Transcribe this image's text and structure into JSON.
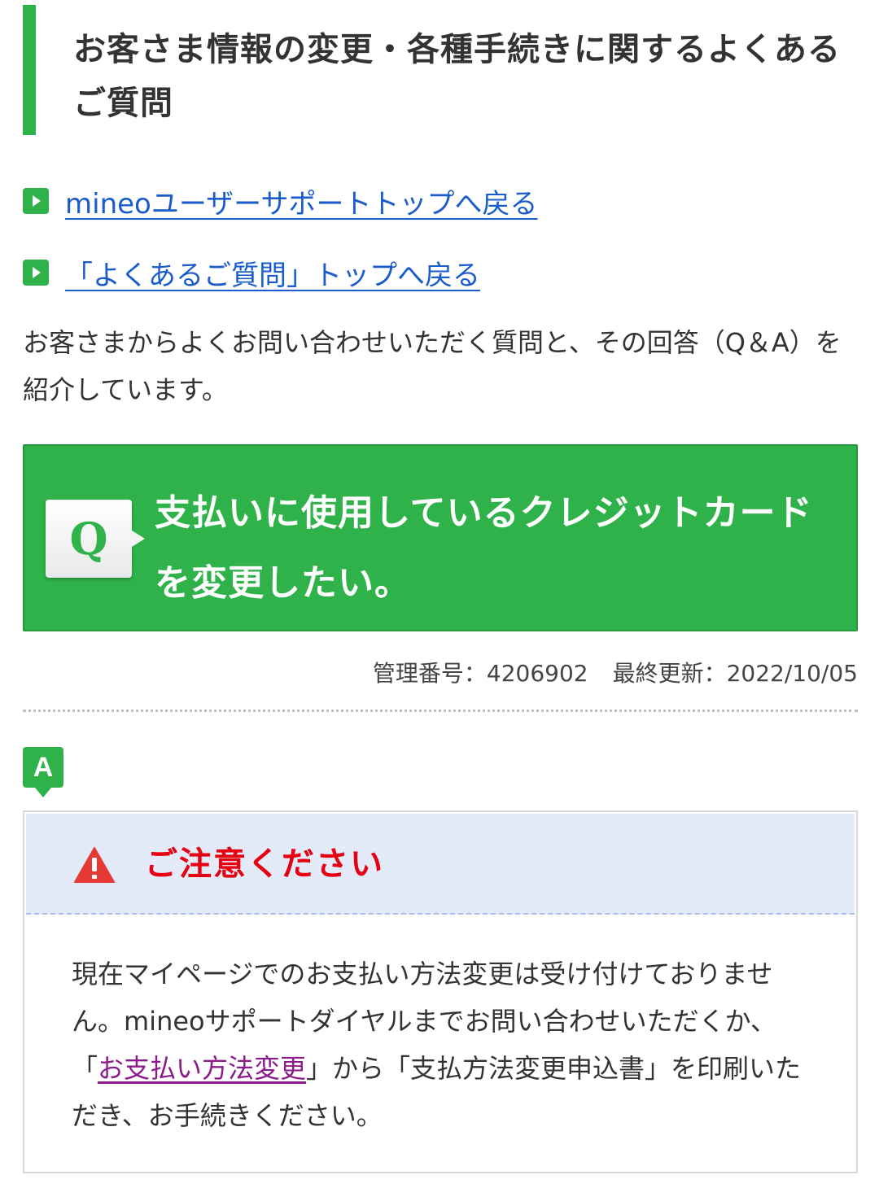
{
  "heading": {
    "title": "お客さま情報の変更・各種手続きに関するよくあるご質問"
  },
  "nav_links": [
    {
      "label": "mineoユーザーサポートトップへ戻る"
    },
    {
      "label": "「よくあるご質問」トップへ戻る"
    }
  ],
  "intro": "お客さまからよくお問い合わせいただく質問と、その回答（Q＆A）を紹介しています。",
  "question": {
    "badge": "Q",
    "text": "支払いに使用しているクレジットカードを変更したい。"
  },
  "meta": {
    "id_label": "管理番号：4206902",
    "updated_label": "最終更新：2022/10/05"
  },
  "answer": {
    "badge": "A"
  },
  "caution": {
    "title": "ご注意ください",
    "body_before": "現在マイページでのお支払い方法変更は受け付けておりません。mineoサポートダイヤルまでお問い合わせいただくか、「",
    "link_label": "お支払い方法変更",
    "body_after": "」から「支払方法変更申込書」を印刷いただき、お手続きください。"
  },
  "colors": {
    "brand_green": "#2fb24a",
    "link_blue": "#1a5ccc",
    "visited_link": "#8b1a8b",
    "caution_red": "#e60012",
    "caution_header_bg": "#e3ebf8"
  },
  "icons": {
    "nav_arrow": "arrow-right-icon",
    "question": "q-icon",
    "answer": "a-icon",
    "warning": "warning-icon"
  }
}
